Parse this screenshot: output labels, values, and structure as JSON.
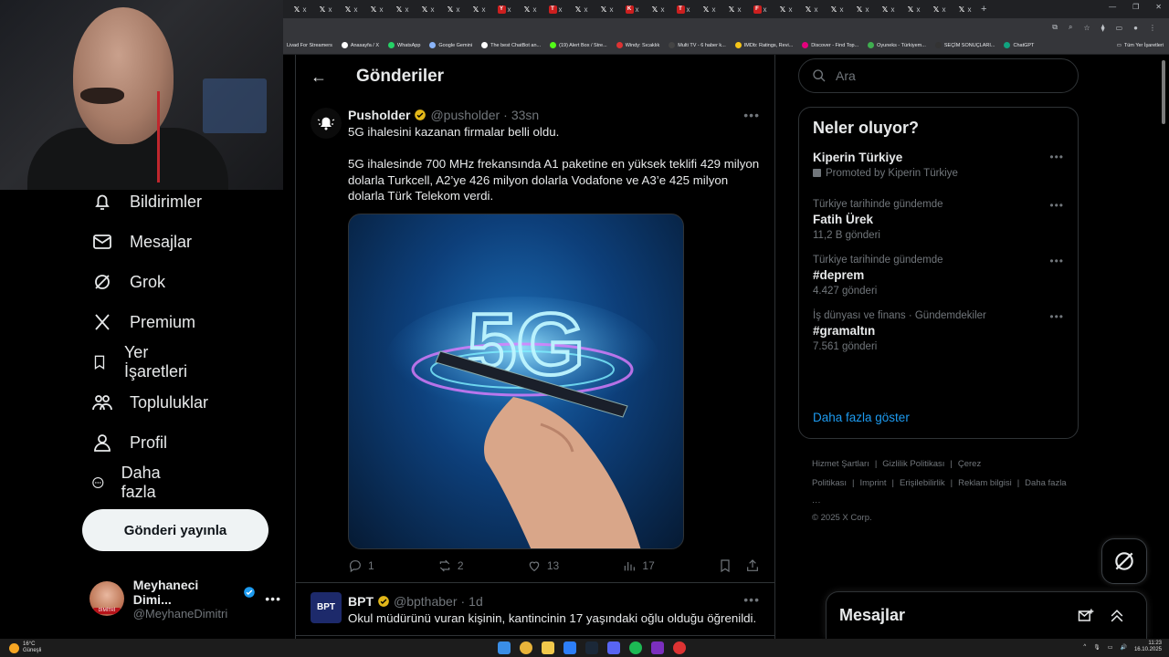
{
  "browser": {
    "tabs": [
      {
        "icon": "x-icon",
        "label": "𝕏",
        "text": "x"
      },
      {
        "icon": "x-icon",
        "label": "𝕏",
        "text": "x"
      },
      {
        "icon": "x-icon",
        "label": "𝕏",
        "text": "x"
      },
      {
        "icon": "x-icon",
        "label": "𝕏",
        "text": "x"
      },
      {
        "icon": "x-icon",
        "label": "𝕏",
        "text": "x"
      },
      {
        "icon": "x-icon",
        "label": "𝕏",
        "text": "x"
      },
      {
        "icon": "x-icon",
        "label": "𝕏",
        "text": "x"
      },
      {
        "icon": "x-icon",
        "label": "𝕏",
        "text": "x"
      },
      {
        "icon": "youtube-icon",
        "label": "Y",
        "text": "x",
        "red": true
      },
      {
        "icon": "x-icon",
        "label": "𝕏",
        "text": "x"
      },
      {
        "icon": "youtube-icon",
        "label": "T",
        "text": "x",
        "red": true
      },
      {
        "icon": "x-icon",
        "label": "𝕏",
        "text": "x"
      },
      {
        "icon": "x-icon",
        "label": "𝕏",
        "text": "x"
      },
      {
        "icon": "youtube-icon",
        "label": "K",
        "text": "x",
        "red": true
      },
      {
        "icon": "x-icon",
        "label": "𝕏",
        "text": "x"
      },
      {
        "icon": "youtube-icon",
        "label": "T",
        "text": "x",
        "red": true
      },
      {
        "icon": "x-icon",
        "label": "𝕏",
        "text": "x"
      },
      {
        "icon": "x-icon",
        "label": "𝕏",
        "text": "x"
      },
      {
        "icon": "youtube-icon",
        "label": "F",
        "text": "x",
        "red": true
      },
      {
        "icon": "x-icon",
        "label": "𝕏",
        "text": "x"
      },
      {
        "icon": "x-icon",
        "label": "𝕏",
        "text": "x"
      },
      {
        "icon": "x-icon",
        "label": "𝕏",
        "text": "x"
      },
      {
        "icon": "x-icon",
        "label": "𝕏",
        "text": "x"
      },
      {
        "icon": "x-icon",
        "label": "𝕏",
        "text": "x"
      },
      {
        "icon": "x-icon",
        "label": "𝕏",
        "text": "x"
      },
      {
        "icon": "x-icon",
        "label": "𝕏",
        "text": "x"
      },
      {
        "icon": "x-icon",
        "label": "𝕏",
        "text": "x"
      }
    ],
    "bookmarks": [
      {
        "label": "Livad For Streamers",
        "color": ""
      },
      {
        "label": "Anasayfa / X",
        "color": "#ffffff"
      },
      {
        "label": "WhatsApp",
        "color": "#25d366"
      },
      {
        "label": "Google Gemini",
        "color": "#8ab4f8"
      },
      {
        "label": "The best ChatBot an...",
        "color": "#ffffff"
      },
      {
        "label": "(19) Alert Box / Stre...",
        "color": "#53fc18"
      },
      {
        "label": "Windy: Sıcaklık",
        "color": "#d33"
      },
      {
        "label": "Multi TV - 6 haber k...",
        "color": "#444"
      },
      {
        "label": "IMDb: Ratings, Revi...",
        "color": "#f5c518"
      },
      {
        "label": "Discover - Find Top...",
        "color": "#e5007d"
      },
      {
        "label": "Oyuneks - Türkiyem...",
        "color": "#3fae4f"
      },
      {
        "label": "SEÇİM SONUÇLARI...",
        "color": "#333"
      },
      {
        "label": "ChatGPT",
        "color": "#10a37f"
      }
    ],
    "bookmarks_folder": "Tüm Yer İşaretleri"
  },
  "nav": {
    "items": [
      {
        "label": "Bildirimler",
        "icon": "bell-icon"
      },
      {
        "label": "Mesajlar",
        "icon": "mail-icon"
      },
      {
        "label": "Grok",
        "icon": "grok-icon"
      },
      {
        "label": "Premium",
        "icon": "x-logo-icon"
      },
      {
        "label": "Yer İşaretleri",
        "icon": "bookmark-icon"
      },
      {
        "label": "Topluluklar",
        "icon": "communities-icon"
      },
      {
        "label": "Profil",
        "icon": "profile-icon"
      },
      {
        "label": "Daha fazla",
        "icon": "more-circle-icon"
      }
    ],
    "post_button": "Gönderi yayınla",
    "account": {
      "name": "Meyhaneci Dimi...",
      "handle": "@MeyhaneDimitri",
      "avatar_text": "DİMİTRİ"
    }
  },
  "main": {
    "title": "Gönderiler",
    "tweets": [
      {
        "name": "Pusholder",
        "handle": "@pusholder",
        "time": "33sn",
        "text": "5G ihalesini kazanan firmalar belli oldu.\n\n5G ihalesinde 700 MHz frekansında A1 paketine en yüksek teklifi 429 milyon dolarla Turkcell, A2’ye 426 milyon dolarla Vodafone ve A3’e 425 milyon dolarla Türk Telekom verdi.",
        "replies": "1",
        "reposts": "2",
        "likes": "13",
        "views": "17"
      },
      {
        "name": "BPT",
        "handle": "@bpthaber",
        "time": "1d",
        "text": "Okul müdürünü vuran kişinin, kantincinin 17 yaşındaki oğlu olduğu öğrenildi.",
        "avatar_text": "BPT"
      }
    ]
  },
  "right": {
    "search_placeholder": "Ara",
    "trends_title": "Neler oluyor?",
    "trends": [
      {
        "context": "",
        "title": "Kiperin Türkiye",
        "count": "Promoted by Kiperin Türkiye",
        "promoted": true
      },
      {
        "context": "Türkiye tarihinde gündemde",
        "title": "Fatih Ürek",
        "count": "11,2 B gönderi"
      },
      {
        "context": "Türkiye tarihinde gündemde",
        "title": "#deprem",
        "count": "4.427 gönderi"
      },
      {
        "context": "İş dünyası ve finans · Gündemdekiler",
        "title": "#gramaltın",
        "count": "7.561 gönderi"
      }
    ],
    "show_more": "Daha fazla göster",
    "footer_links": [
      "Hizmet Şartları",
      "|",
      "Gizlilik Politikası",
      "|",
      "Çerez Politikası",
      "|",
      "Imprint",
      "|",
      "Erişilebilirlik",
      "|",
      "Reklam bilgisi",
      "|",
      "Daha fazla ···"
    ],
    "copyright": "© 2025 X Corp.",
    "messages_drawer": "Mesajlar"
  },
  "taskbar": {
    "temp": "16°C",
    "weather": "Güneşli",
    "time": "11:23",
    "date": "16.10.2025"
  },
  "colors": {
    "accent": "#1d9bf0",
    "bg": "#000000",
    "border": "#2f3336",
    "verified": "#e2b719"
  }
}
